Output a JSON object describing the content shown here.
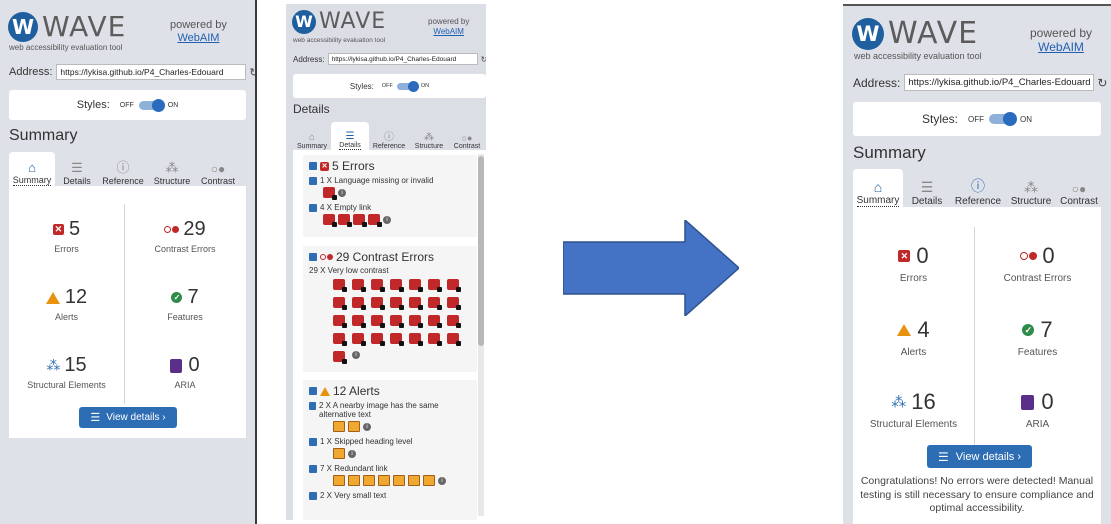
{
  "brand": {
    "name": "WAVE",
    "tagline": "web accessibility evaluation tool",
    "powered_by": "powered by",
    "webaim": "WebAIM"
  },
  "address": {
    "label": "Address:",
    "value": "https://lykisa.github.io/P4_Charles-Edouard"
  },
  "styles": {
    "label": "Styles:",
    "off": "OFF",
    "on": "ON"
  },
  "tabs": [
    "Summary",
    "Details",
    "Reference",
    "Structure",
    "Contrast"
  ],
  "summary_heading": "Summary",
  "details_heading": "Details",
  "view_details": "View details ›",
  "stat_labels": {
    "errors": "Errors",
    "contrast": "Contrast Errors",
    "alerts": "Alerts",
    "features": "Features",
    "structural": "Structural Elements",
    "aria": "ARIA"
  },
  "before": {
    "errors": "5",
    "contrast": "29",
    "alerts": "12",
    "features": "7",
    "structural": "15",
    "aria": "0"
  },
  "after": {
    "errors": "0",
    "contrast": "0",
    "alerts": "4",
    "features": "7",
    "structural": "16",
    "aria": "0"
  },
  "details": {
    "errors_title": "5 Errors",
    "lang": "1 X Language missing or invalid",
    "empty_link": "4 X Empty link",
    "contrast_title": "29 Contrast Errors",
    "low_contrast": "29 X Very low contrast",
    "alerts_title": "12 Alerts",
    "nearby": "2 X A nearby image has the same alternative text",
    "skipped": "1 X Skipped heading level",
    "redundant": "7 X Redundant link",
    "small_text": "2 X Very small text"
  },
  "congrats": "Congratulations! No errors were detected! Manual testing is still necessary to ensure compliance and optimal accessibility.",
  "colors": {
    "accent": "#2d6db3",
    "error": "#c0282a",
    "alert": "#e8930f",
    "feature": "#2e8b4a",
    "aria": "#5a2f8a",
    "arrow": "#4472c4"
  }
}
